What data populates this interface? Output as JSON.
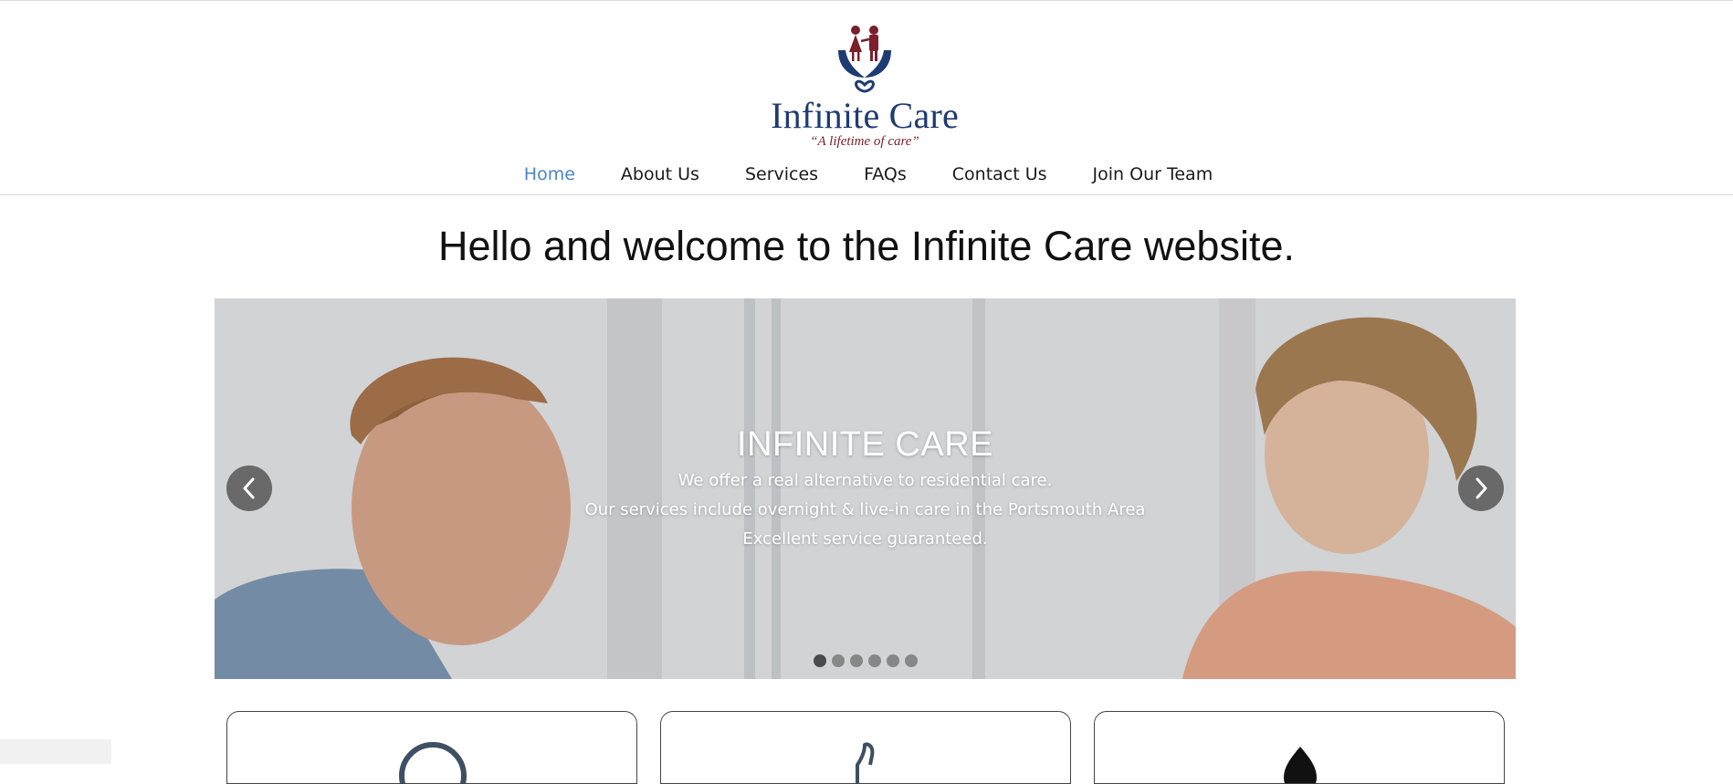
{
  "logo": {
    "title": "Infinite Care",
    "tagline": "“A lifetime of care”",
    "colors": {
      "navy": "#1f3b73",
      "maroon": "#7a1f2b"
    }
  },
  "nav": {
    "items": [
      {
        "label": "Home",
        "active": true
      },
      {
        "label": "About Us"
      },
      {
        "label": "Services"
      },
      {
        "label": "FAQs"
      },
      {
        "label": "Contact Us"
      },
      {
        "label": "Join Our Team"
      }
    ],
    "active_color": "#4a86c5"
  },
  "welcome": {
    "heading": "Hello and welcome to the Infinite Care website."
  },
  "slider": {
    "title": "INFINITE CARE",
    "lines": [
      "We offer a real alternative to residential care.",
      "Our services include overnight & live-in care in the Portsmouth Area",
      "Excellent service guaranteed."
    ],
    "prev_icon": "chevron-left-icon",
    "next_icon": "chevron-right-icon",
    "dot_count": 6,
    "active_dot": 1
  },
  "cards": [
    {
      "icon": "clock-icon"
    },
    {
      "icon": "thumbs-up-icon"
    },
    {
      "icon": "drop-icon"
    }
  ]
}
